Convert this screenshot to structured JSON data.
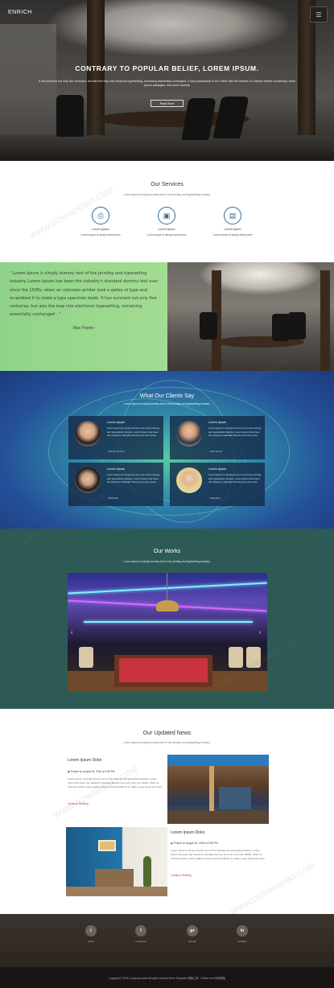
{
  "header": {
    "brand": "ENRICH",
    "menu_icon": "menu-icon"
  },
  "hero": {
    "title": "CONTRARY TO POPULAR BELIEF, LOREM IPSUM.",
    "text": "It has survived not only five centuries, but also the leap into electronic typesetting, remaining essentially unchanged. It was popularised in the 1960s with the release of Letraset sheets containing Lorem Ipsum passages, and more recently",
    "button": "Read More"
  },
  "services": {
    "title": "Our Services",
    "subtitle": "Lorem Ipsum is simply dummy text of the printing and typesetting industry.",
    "items": [
      {
        "icon": "printer-icon",
        "title": "Lorem Ipsum",
        "text": "Lorem Ipsum is simply dummy text"
      },
      {
        "icon": "notebook-icon",
        "title": "Lorem Ipsum",
        "text": "Lorem Ipsum is simply dummy text"
      },
      {
        "icon": "document-icon",
        "title": "Lorem Ipsum",
        "text": "Lorem Ipsum is simply dummy text"
      }
    ]
  },
  "quote": {
    "text": "\" Lorem Ipsum is simply dummy text of the printing and typesetting industry. Lorem Ipsum has been the industry's standard dummy text ever since the 1500s, when an unknown printer took a galley of type and scrambled it to make a type specimen book. It has survived not only five centuries, but also the leap into electronic typesetting, remaining essentially unchanged . \"",
    "author": "- Max Payne -"
  },
  "clients": {
    "title": "What Our Clients Say",
    "subtitle": "Lorem Ipsum is simply dummy text of the printing and typesetting industry.",
    "items": [
      {
        "name": "Lorem Ipsum",
        "text": "Lorem Ipsum is simply dummy text of the printing and typesetting industry. Lorem Ipsum has been the industry's standard dummy text ever since.",
        "sign": "- Nicole Simmon"
      },
      {
        "name": "Lorem Ipsum",
        "text": "Lorem Ipsum is simply dummy text of the printing and typesetting industry. Lorem Ipsum has been the industry's standard dummy text ever since.",
        "sign": "- John Conor"
      },
      {
        "name": "Lorem Ipsum",
        "text": "Lorem Ipsum is simply dummy text of the printing and typesetting industry. Lorem Ipsum has been the industry's standard dummy text ever since.",
        "sign": "- Elizabeth"
      },
      {
        "name": "Lorem Ipsum",
        "text": "Lorem Ipsum is simply dummy text of the printing and typesetting industry. Lorem Ipsum has been the industry's standard dummy text ever since.",
        "sign": "- Cleopatra"
      }
    ]
  },
  "works": {
    "title": "Our Works",
    "subtitle": "Lorem Ipsum is simply dummy text of the printing and typesetting industry.",
    "prev": "‹",
    "next": "›"
  },
  "news": {
    "title": "Our Updated News",
    "subtitle": "Lorem Ipsum is simply dummy text of the printing and typesetting industry.",
    "items": [
      {
        "title": "Lorem Ipsum Dolor",
        "meta": "Posted on August 26, 2016 at 2:58 PM",
        "text": "Lorem Ipsum is simply dummy text of the printing and typesetting industry. Lorem Ipsum has been the industry's standard dummy text ever since the 1500s, when an unknown printer took a galley of type and scrambled it to make a type specimen book.",
        "link": "Continue Reading"
      },
      {
        "title": "Lorem Ipsum Dolor",
        "meta": "Posted on August 26, 2016 at 2:58 PM",
        "text": "Lorem Ipsum is simply dummy text of the printing and typesetting industry. Lorem Ipsum has been the industry's standard dummy text ever since the 1500s, when an unknown printer took a galley of type and scrambled it to make a type specimen book.",
        "link": "Continue Reading"
      }
    ]
  },
  "footer": {
    "social": [
      {
        "icon": "twitter-icon",
        "glyph": "t",
        "label": "Twitter"
      },
      {
        "icon": "facebook-icon",
        "glyph": "f",
        "label": "Facebook"
      },
      {
        "icon": "google-plus-icon",
        "glyph": "g+",
        "label": "Google"
      },
      {
        "icon": "linkedin-icon",
        "glyph": "in",
        "label": "LinkedIn"
      }
    ],
    "copyright": "Copyright © 2016 Company name All rights reserved.More Templates 模板之家 - Collect from 网页模板"
  },
  "watermark": "WWW.DOWNDEMO.COM"
}
